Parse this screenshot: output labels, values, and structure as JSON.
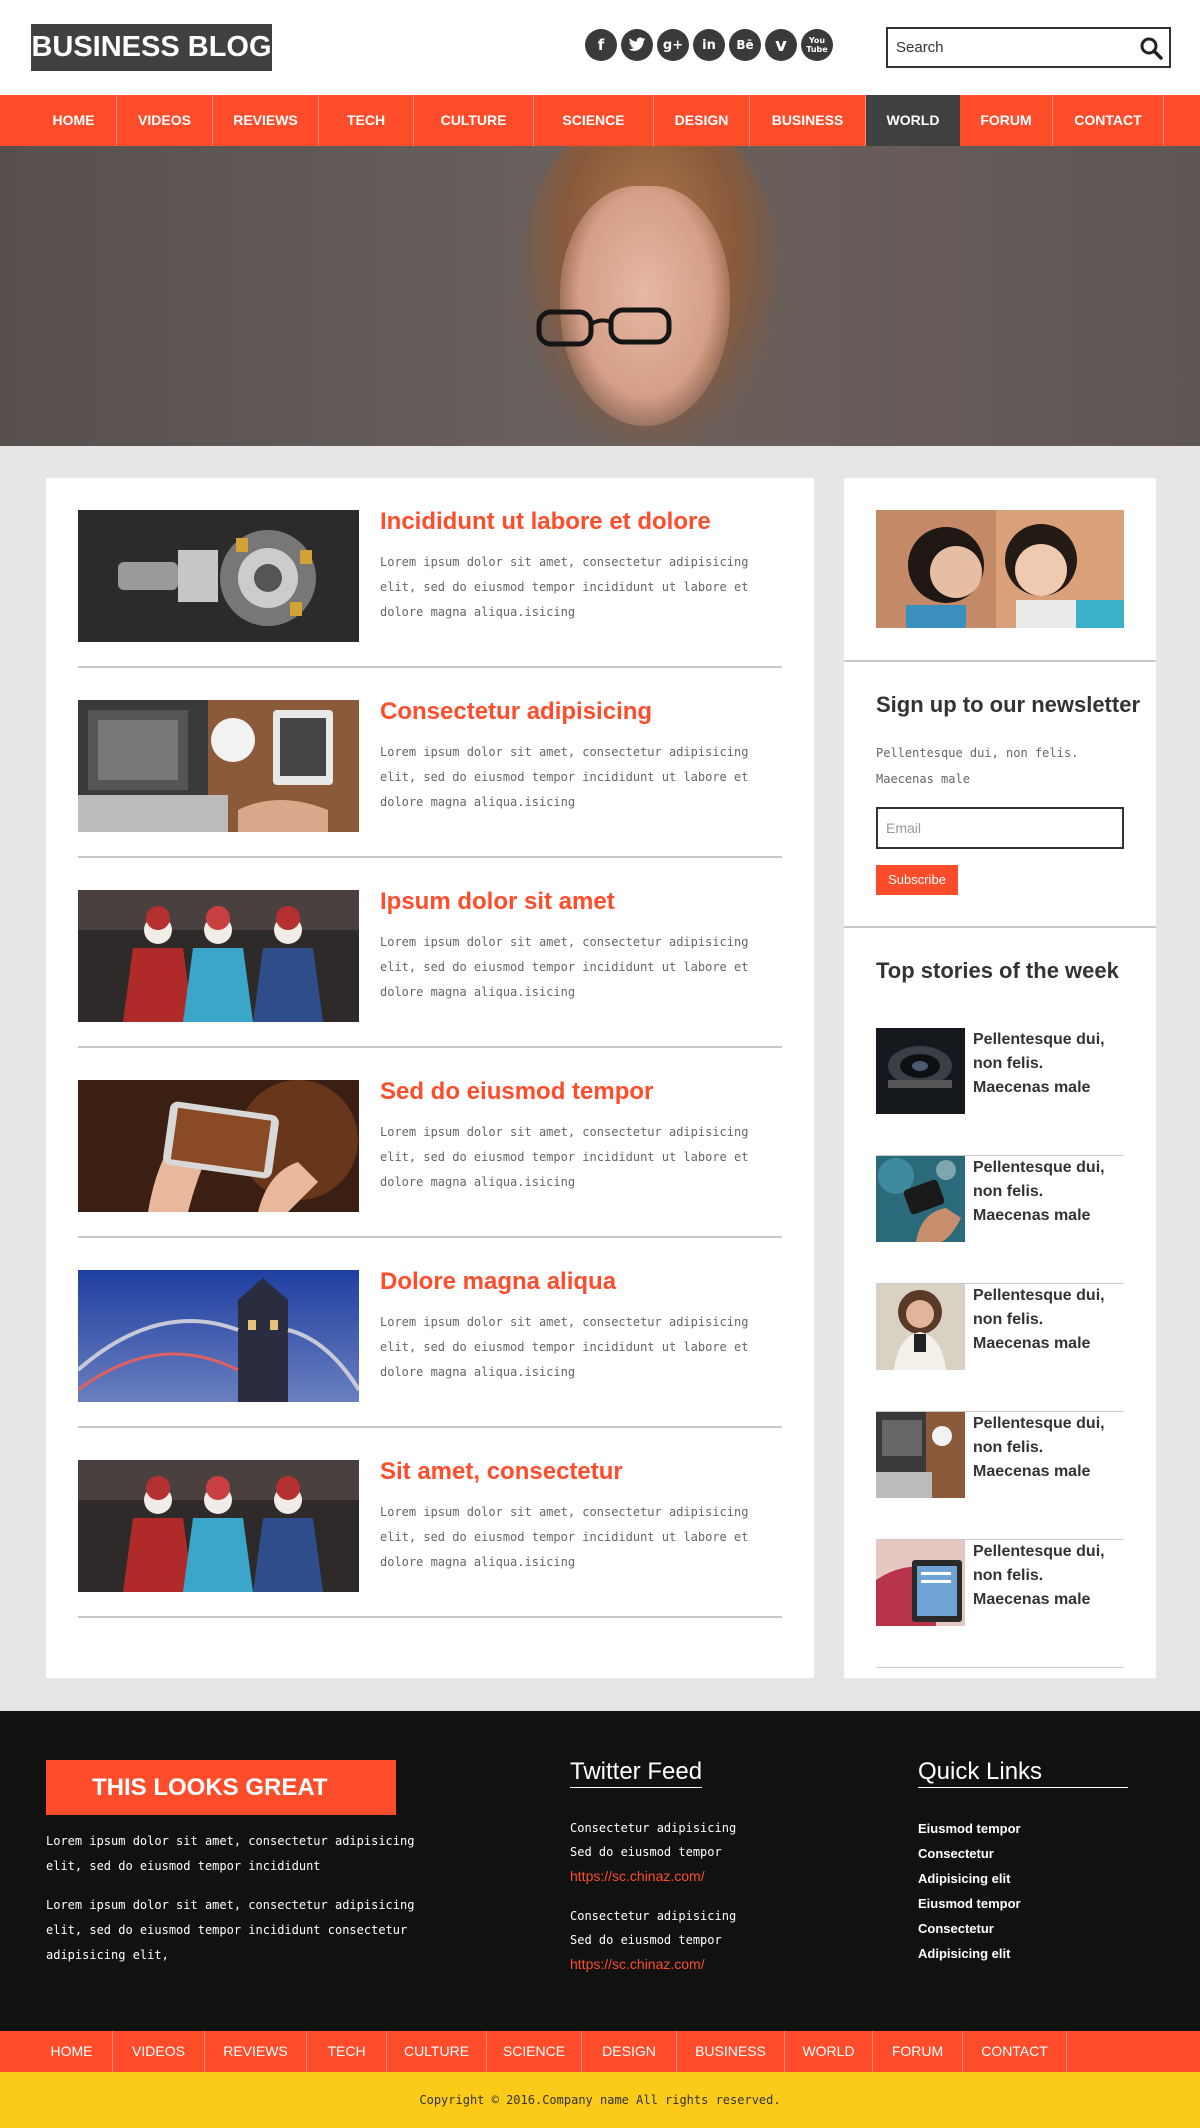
{
  "header": {
    "logo": "BUSINESS BLOG",
    "social": [
      {
        "icon": "facebook-icon",
        "glyph": "f"
      },
      {
        "icon": "twitter-icon",
        "glyph": "t"
      },
      {
        "icon": "google-plus-icon",
        "glyph": "g+"
      },
      {
        "icon": "linkedin-icon",
        "glyph": "in"
      },
      {
        "icon": "behance-icon",
        "glyph": "Bē"
      },
      {
        "icon": "vimeo-icon",
        "glyph": "v"
      },
      {
        "icon": "youtube-icon",
        "glyph": "You"
      }
    ],
    "search_placeholder": "Search"
  },
  "nav": {
    "items": [
      "HOME",
      "VIDEOS",
      "REVIEWS",
      "TECH",
      "CULTURE",
      "SCIENCE",
      "DESIGN",
      "BUSINESS",
      "WORLD",
      "FORUM",
      "CONTACT"
    ],
    "active": "WORLD"
  },
  "posts": [
    {
      "title": "Incididunt ut labore et dolore",
      "body": "Lorem ipsum dolor sit amet, consectetur adipisicing elit, sed do eiusmod tempor incididunt ut labore et dolore magna aliqua.isicing"
    },
    {
      "title": "Consectetur adipisicing",
      "body": "Lorem ipsum dolor sit amet, consectetur adipisicing elit, sed do eiusmod tempor incididunt ut labore et dolore magna aliqua.isicing"
    },
    {
      "title": "Ipsum dolor sit amet",
      "body": "Lorem ipsum dolor sit amet, consectetur adipisicing elit, sed do eiusmod tempor incididunt ut labore et dolore magna aliqua.isicing"
    },
    {
      "title": "Sed do eiusmod tempor",
      "body": "Lorem ipsum dolor sit amet, consectetur adipisicing elit, sed do eiusmod tempor incididunt ut labore et dolore magna aliqua.isicing"
    },
    {
      "title": "Dolore magna aliqua",
      "body": "Lorem ipsum dolor sit amet, consectetur adipisicing elit, sed do eiusmod tempor incididunt ut labore et dolore magna aliqua.isicing"
    },
    {
      "title": "Sit amet, consectetur",
      "body": "Lorem ipsum dolor sit amet, consectetur adipisicing elit, sed do eiusmod tempor incididunt ut labore et dolore magna aliqua.isicing"
    }
  ],
  "sidebar": {
    "newsletter_title": "Sign up to our newsletter",
    "newsletter_text": "Pellentesque dui, non felis. Maecenas male",
    "email_placeholder": "Email",
    "subscribe_label": "Subscribe",
    "top_title": "Top stories of the week",
    "stories": [
      "Pellentesque dui, non felis. Maecenas male",
      "Pellentesque dui, non felis. Maecenas male",
      "Pellentesque dui, non felis. Maecenas male",
      "Pellentesque dui, non felis. Maecenas male",
      "Pellentesque dui, non felis. Maecenas male"
    ]
  },
  "footer": {
    "badge": "THIS LOOKS GREAT",
    "para1": "Lorem ipsum dolor sit amet, consectetur adipisicing elit, sed do eiusmod tempor incididunt",
    "para2": "Lorem ipsum dolor sit amet, consectetur adipisicing elit, sed do eiusmod tempor incididunt consectetur adipisicing elit,",
    "twitter_title": "Twitter Feed",
    "tweets": [
      {
        "line1": "Consectetur adipisicing",
        "line2": "Sed do eiusmod tempor",
        "link": "https://sc.chinaz.com/"
      },
      {
        "line1": "Consectetur adipisicing",
        "line2": "Sed do eiusmod tempor",
        "link": "https://sc.chinaz.com/"
      }
    ],
    "links_title": "Quick Links",
    "links": [
      "Eiusmod tempor",
      "Consectetur",
      "Adipisicing elit",
      "Eiusmod tempor",
      "Consectetur",
      "Adipisicing elit"
    ],
    "copyright": "Copyright © 2016.Company name All rights reserved."
  },
  "colors": {
    "accent": "#ff4d2b",
    "dark": "#404040",
    "footer": "#111111",
    "yellow": "#fcca18"
  }
}
